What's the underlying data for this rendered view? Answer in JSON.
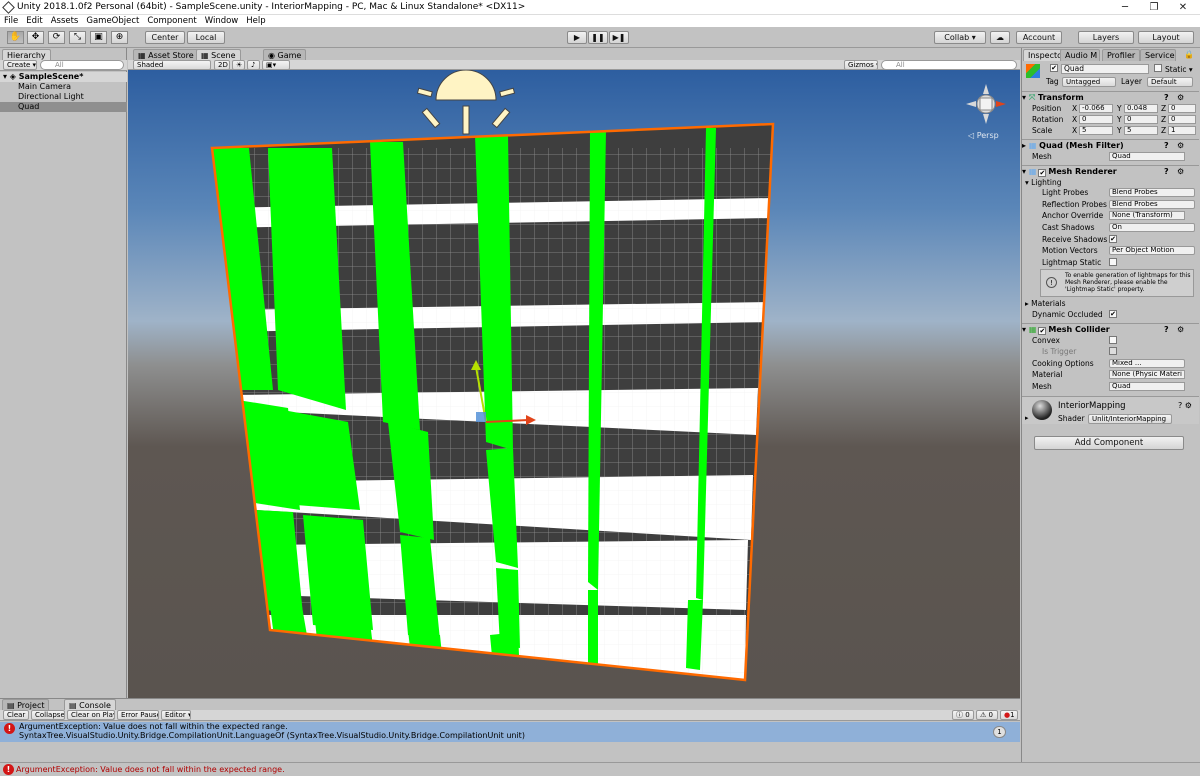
{
  "window": {
    "title": "Unity 2018.1.0f2 Personal (64bit) - SampleScene.unity - InteriorMapping - PC, Mac & Linux Standalone* <DX11>",
    "minimize": "─",
    "maximize": "❐",
    "close": "✕"
  },
  "menus": [
    "File",
    "Edit",
    "Assets",
    "GameObject",
    "Component",
    "Window",
    "Help"
  ],
  "toolbar": {
    "center": "Center",
    "local": "Local",
    "collab": "Collab ▾",
    "account": "Account",
    "layers": "Layers",
    "layout": "Layout"
  },
  "hierarchy": {
    "tab": "Hierarchy",
    "create": "Create ▾",
    "search_placeholder": "All",
    "scene": "SampleScene*",
    "items": [
      "Main Camera",
      "Directional Light",
      "Quad"
    ]
  },
  "scene_tabs": {
    "asset_store": "Asset Store",
    "scene": "Scene",
    "game": "Game"
  },
  "scene_bar": {
    "shading": "Shaded",
    "mode_2d": "2D",
    "gizmos": "Gizmos ▾",
    "search_placeholder": "All",
    "persp": "◁ Persp"
  },
  "inspector": {
    "tabs": [
      "Inspector",
      "Audio M",
      "Profiler",
      "Services"
    ],
    "object_name": "Quad",
    "static_label": "Static ▾",
    "tag_label": "Tag",
    "tag_value": "Untagged",
    "layer_label": "Layer",
    "layer_value": "Default",
    "transform": {
      "title": "Transform",
      "position_label": "Position",
      "position": {
        "x": "-0.066",
        "y": "0.048",
        "z": "0"
      },
      "rotation_label": "Rotation",
      "rotation": {
        "x": "0",
        "y": "0",
        "z": "0"
      },
      "scale_label": "Scale",
      "scale": {
        "x": "5",
        "y": "5",
        "z": "1"
      }
    },
    "mesh_filter": {
      "title": "Quad (Mesh Filter)",
      "mesh_label": "Mesh",
      "mesh_value": "Quad"
    },
    "mesh_renderer": {
      "title": "Mesh Renderer",
      "lighting": "Lighting",
      "light_probes_label": "Light Probes",
      "light_probes": "Blend Probes",
      "reflection_probes_label": "Reflection Probes",
      "reflection_probes": "Blend Probes",
      "anchor_override_label": "Anchor Override",
      "anchor_override": "None (Transform)",
      "cast_shadows_label": "Cast Shadows",
      "cast_shadows": "On",
      "receive_shadows_label": "Receive Shadows",
      "motion_vectors_label": "Motion Vectors",
      "motion_vectors": "Per Object Motion",
      "lightmap_static_label": "Lightmap Static",
      "info": "To enable generation of lightmaps for this Mesh Renderer, please enable the 'Lightmap Static' property.",
      "materials": "Materials",
      "dynamic_occluded": "Dynamic Occluded"
    },
    "mesh_collider": {
      "title": "Mesh Collider",
      "convex": "Convex",
      "is_trigger": "Is Trigger",
      "cooking_options_label": "Cooking Options",
      "cooking_options": "Mixed ...",
      "material_label": "Material",
      "material": "None (Physic Materi",
      "mesh_label": "Mesh",
      "mesh": "Quad"
    },
    "material": {
      "name": "InteriorMapping",
      "shader_label": "Shader",
      "shader": "Unlit/InteriorMapping"
    },
    "add_component": "Add Component"
  },
  "bottom": {
    "project_tab": "Project",
    "console_tab": "Console",
    "clear": "Clear",
    "collapse": "Collapse",
    "clear_on_play": "Clear on Play",
    "error_pause": "Error Pause",
    "editor": "Editor ▾",
    "count_info": "0",
    "count_warn": "0",
    "count_error": "1",
    "log_line1": "ArgumentException: Value does not fall within the expected range.",
    "log_line2": "SyntaxTree.VisualStudio.Unity.Bridge.CompilationUnit.LanguageOf (SyntaxTree.VisualStudio.Unity.Bridge.CompilationUnit unit)",
    "log_count": "1"
  },
  "status": {
    "message": "ArgumentException: Value does not fall within the expected range."
  },
  "colors": {
    "accent_green": "#00ff00",
    "wall_dark": "#3e3e3e",
    "floor_white": "#ffffff",
    "selection_outline": "#ff6a00",
    "error_red": "#d31616"
  }
}
